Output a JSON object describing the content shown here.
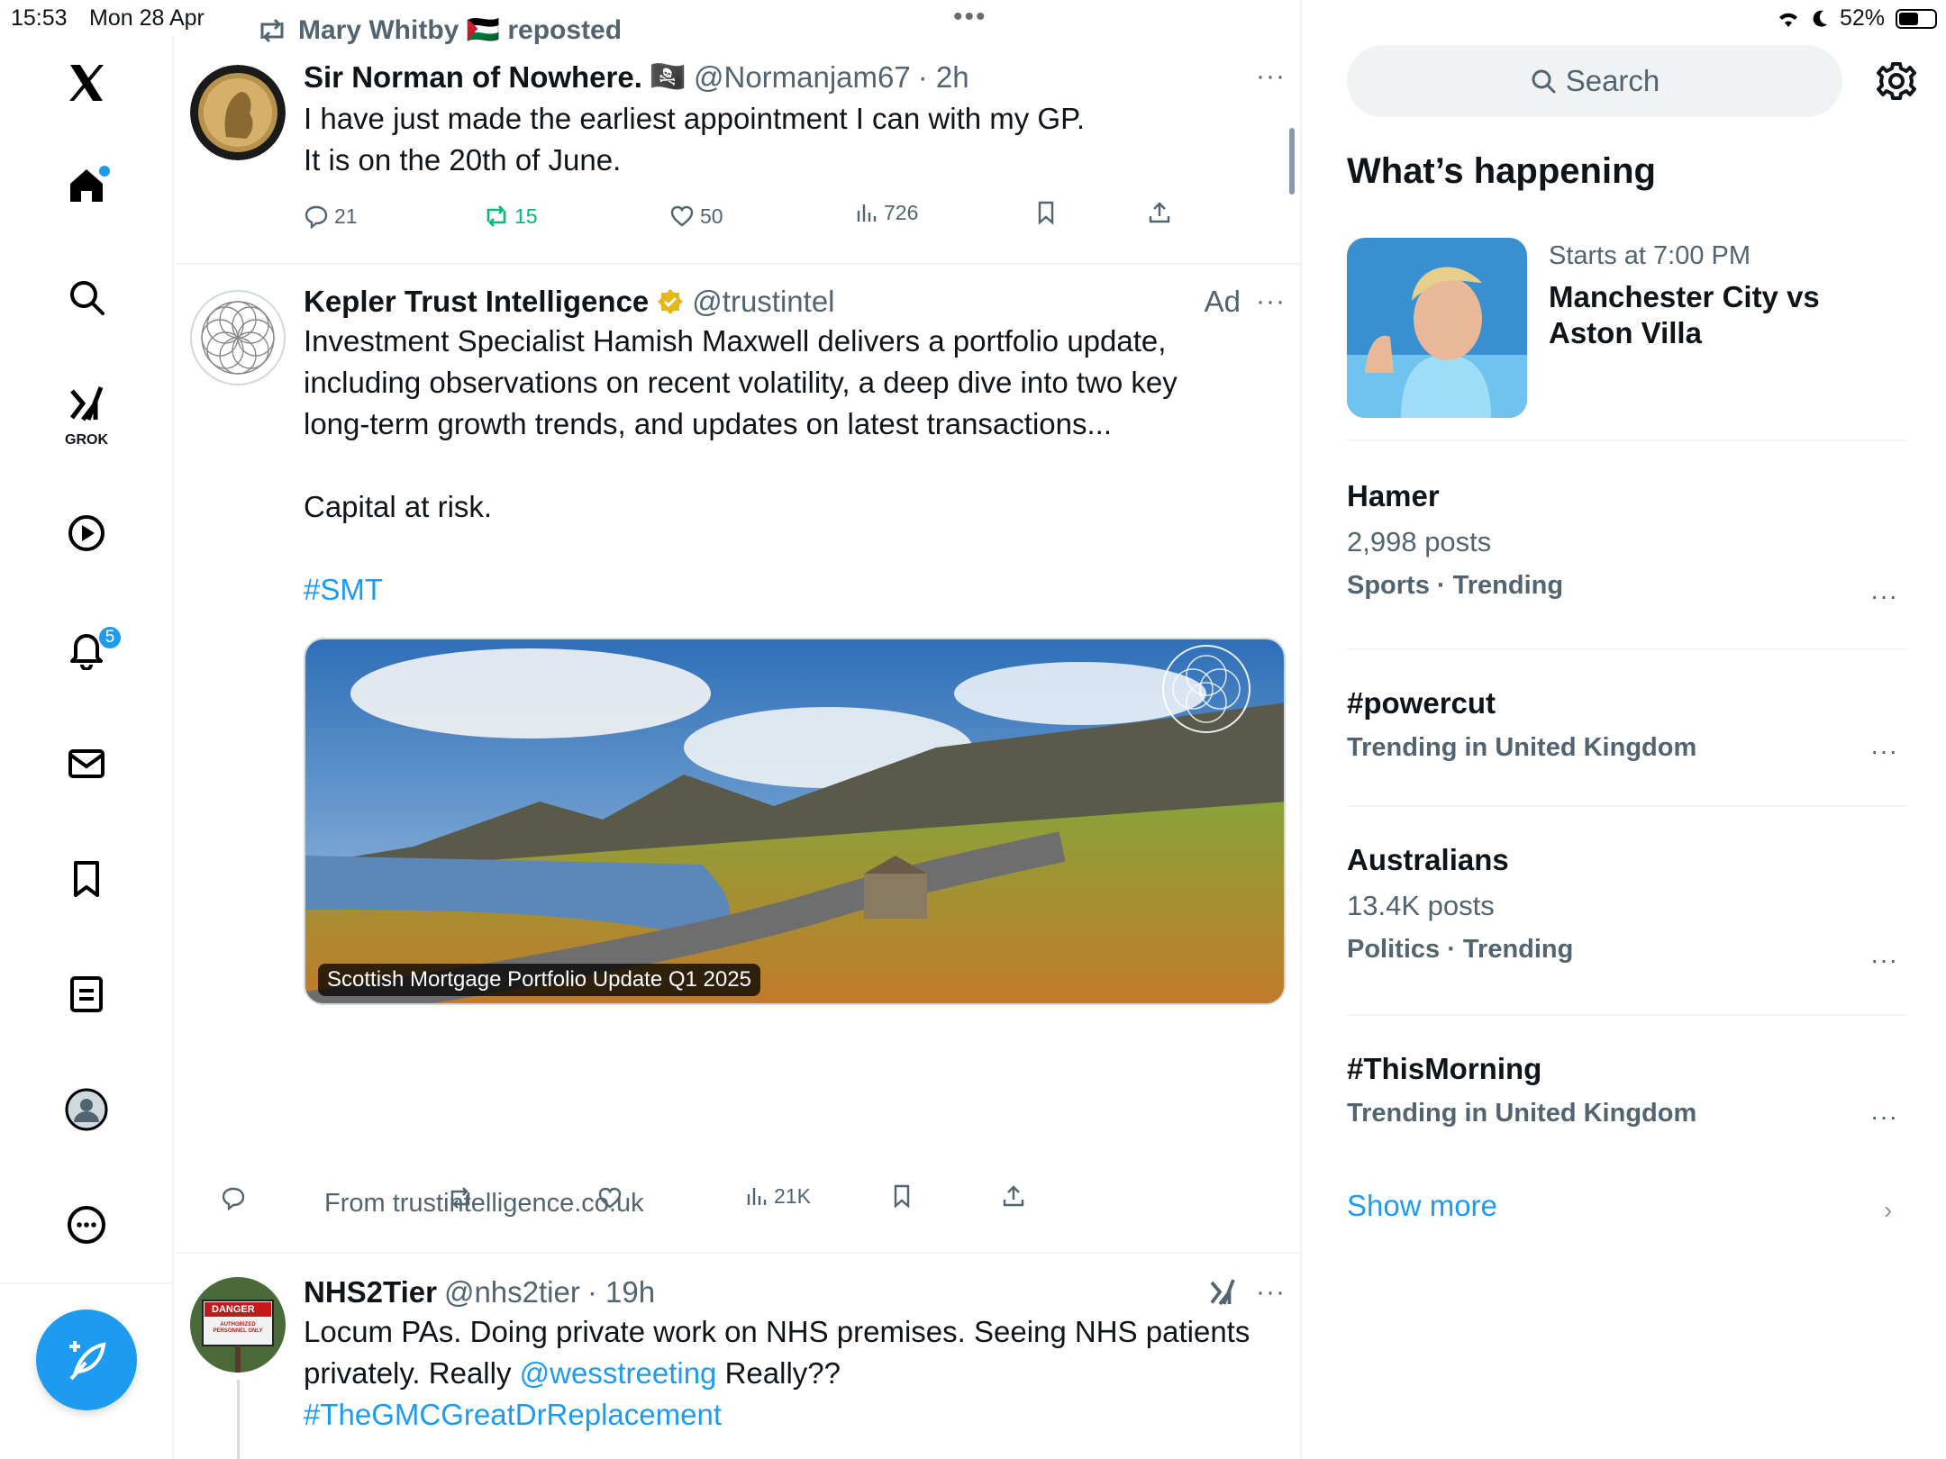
{
  "status": {
    "time": "15:53",
    "date": "Mon 28 Apr",
    "battery": "52%",
    "top_dots": "•••"
  },
  "nav": {
    "grok_label": "GROK",
    "notifications_count": "5"
  },
  "feed": {
    "post1": {
      "repost_by": "Mary Whitby 🇵🇸 reposted",
      "name": "Sir Norman of Nowhere.",
      "flag": "🏴‍☠️",
      "handle": "@Normanjam67",
      "time": "· 2h",
      "more": "···",
      "line1": "I have just made the earliest appointment I can with my GP.",
      "line2": "It is on the 20th of June.",
      "replies": "21",
      "reposts": "15",
      "likes": "50",
      "views": "726"
    },
    "post2": {
      "name": "Kepler Trust Intelligence",
      "handle": "@trustintel",
      "ad_label": "Ad",
      "more": "···",
      "line1": "Investment Specialist Hamish Maxwell delivers a portfolio update,",
      "line2": "including observations on recent volatility, a deep dive into two key",
      "line3": "long-term growth trends, and updates on latest transactions...",
      "line4": "Capital at risk.",
      "hashtag": "#SMT",
      "media_caption": "Scottish Mortgage Portfolio Update Q1 2025",
      "media_from": "From trustintelligence.co.uk",
      "views": "21K"
    },
    "post3": {
      "name": "NHS2Tier",
      "handle": "@nhs2tier",
      "time": "· 19h",
      "more": "···",
      "line1": "Locum PAs. Doing private work on NHS premises. Seeing NHS patients",
      "line2_prefix": "privately. Really ",
      "line2_mention": "@wesstreeting",
      "line2_suffix": " Really??",
      "line3": "#TheGMCGreatDrReplacement",
      "avatar_sign_title": "DANGER",
      "avatar_sign_text": "AUTHORIZED PERSONNEL ONLY"
    }
  },
  "sidebar": {
    "search_placeholder": "Search",
    "title": "What’s happening",
    "event": {
      "time": "Starts at 7:00 PM",
      "title": "Manchester City vs Aston Villa"
    },
    "trends": [
      {
        "name": "Hamer",
        "count": "2,998 posts",
        "category": "Sports · Trending",
        "more": "···"
      },
      {
        "name": "#powercut",
        "count": "",
        "category": "Trending in United Kingdom",
        "more": "···"
      },
      {
        "name": "Australians",
        "count": "13.4K posts",
        "category": "Politics · Trending",
        "more": "···"
      },
      {
        "name": "#ThisMorning",
        "count": "",
        "category": "Trending in United Kingdom",
        "more": "···"
      }
    ],
    "show_more": "Show more",
    "chevron": "›"
  },
  "colors": {
    "accent": "#1d9bf0",
    "repost_green": "#00ba7c",
    "muted": "#536471"
  }
}
